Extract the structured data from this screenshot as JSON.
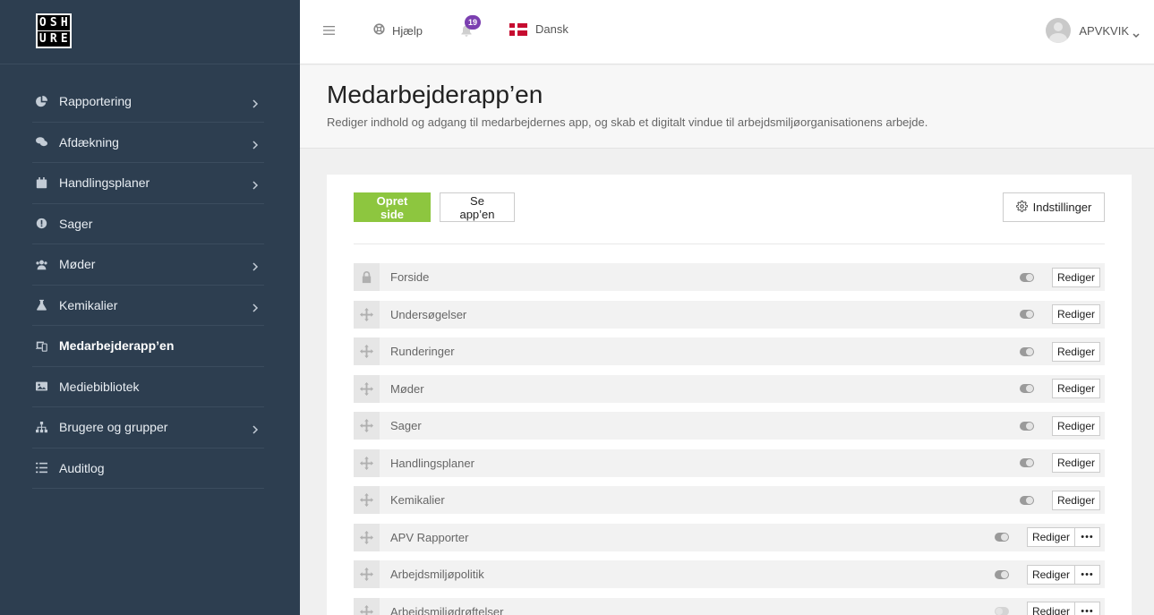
{
  "logo": {
    "letters": [
      "O",
      "S",
      "H",
      "U",
      "R",
      "E"
    ]
  },
  "sidebar": {
    "items": [
      {
        "label": "Rapportering",
        "icon": "pie-chart-icon",
        "has_chevron": true
      },
      {
        "label": "Afdækning",
        "icon": "chat-bubbles-icon",
        "has_chevron": true
      },
      {
        "label": "Handlingsplaner",
        "icon": "calendar-icon",
        "has_chevron": true
      },
      {
        "label": "Sager",
        "icon": "exclamation-circle-icon",
        "has_chevron": false
      },
      {
        "label": "Møder",
        "icon": "users-icon",
        "has_chevron": true
      },
      {
        "label": "Kemikalier",
        "icon": "flask-icon",
        "has_chevron": true
      },
      {
        "label": "Medarbejderapp’en",
        "icon": "devices-icon",
        "has_chevron": false,
        "active": true
      },
      {
        "label": "Mediebibliotek",
        "icon": "image-icon",
        "has_chevron": false
      },
      {
        "label": "Brugere og grupper",
        "icon": "sitemap-icon",
        "has_chevron": true
      },
      {
        "label": "Auditlog",
        "icon": "list-icon",
        "has_chevron": false
      }
    ]
  },
  "topbar": {
    "help_label": "Hjælp",
    "notification_count": "19",
    "language_label": "Dansk",
    "username": "APVKVIK"
  },
  "page": {
    "title": "Medarbejderapp’en",
    "subtitle": "Rediger indhold og adgang til medarbejdernes app, og skab et digitalt vindue til arbejdsmiljøorganisationens arbejde."
  },
  "toolbar": {
    "create_label": "Opret side",
    "see_app_label": "Se app’en",
    "settings_label": "Indstillinger"
  },
  "edit_label": "Rediger",
  "rows": [
    {
      "title": "Forside",
      "locked": true,
      "toggle_on": true,
      "has_more": false
    },
    {
      "title": "Undersøgelser",
      "locked": false,
      "toggle_on": true,
      "has_more": false
    },
    {
      "title": "Runderinger",
      "locked": false,
      "toggle_on": true,
      "has_more": false
    },
    {
      "title": "Møder",
      "locked": false,
      "toggle_on": true,
      "has_more": false
    },
    {
      "title": "Sager",
      "locked": false,
      "toggle_on": true,
      "has_more": false
    },
    {
      "title": "Handlingsplaner",
      "locked": false,
      "toggle_on": true,
      "has_more": false
    },
    {
      "title": "Kemikalier",
      "locked": false,
      "toggle_on": true,
      "has_more": false
    },
    {
      "title": "APV Rapporter",
      "locked": false,
      "toggle_on": true,
      "has_more": true
    },
    {
      "title": "Arbejdsmiljøpolitik",
      "locked": false,
      "toggle_on": true,
      "has_more": true
    },
    {
      "title": "Arbejdsmiljødrøftelser",
      "locked": false,
      "toggle_on": false,
      "has_more": true
    }
  ],
  "colors": {
    "sidebar_bg": "#2d3e50",
    "primary_green": "#8dc63f",
    "badge_purple": "#7b3fb0"
  }
}
